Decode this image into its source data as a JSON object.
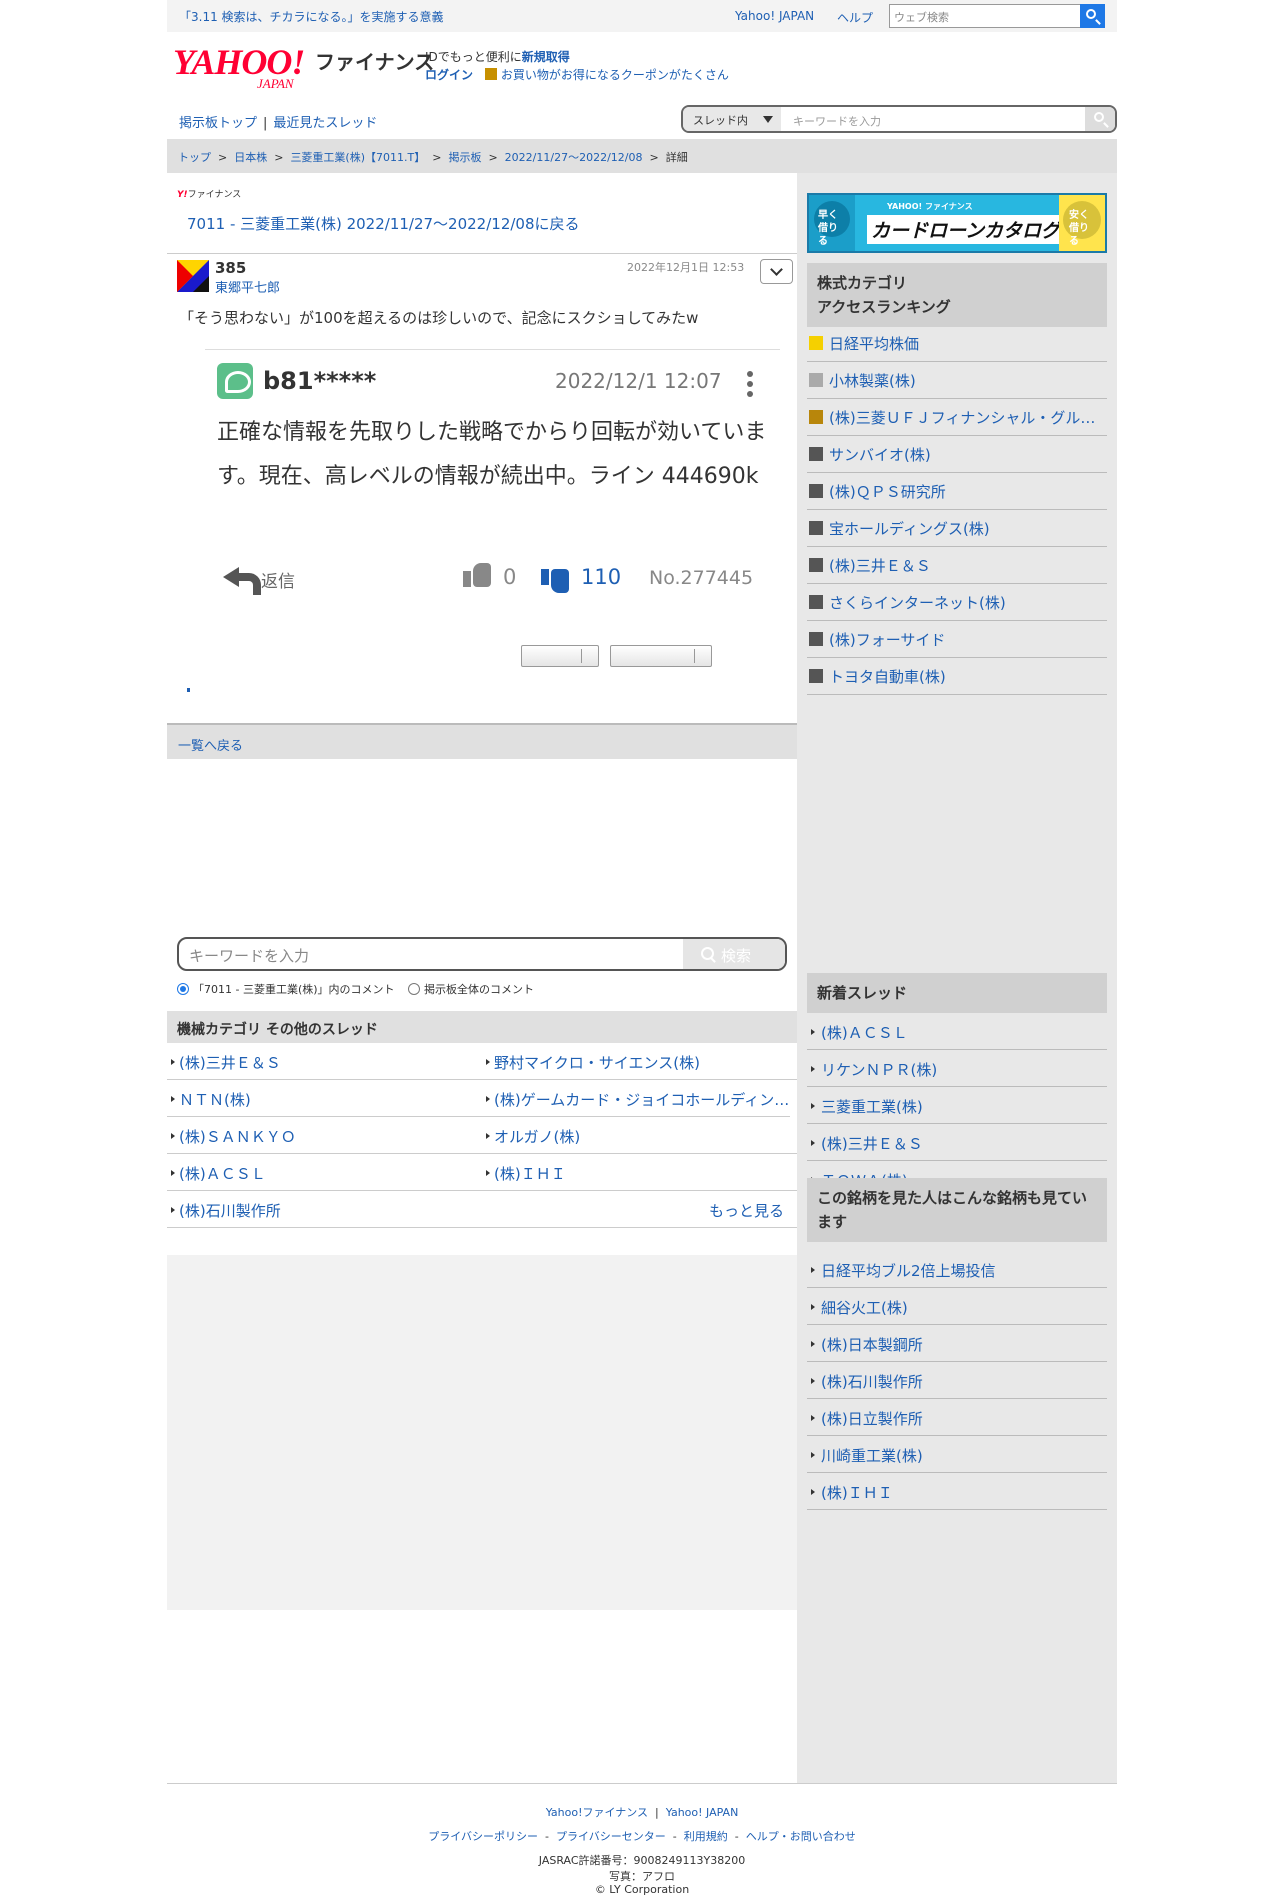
{
  "topbar": {
    "notice": "「3.11 検索は、チカラになる。」を実施する意義",
    "yahoo_japan": "Yahoo! JAPAN",
    "help": "ヘルプ",
    "web_search_placeholder": "ウェブ検索"
  },
  "header": {
    "logo_text": "YAHOO!",
    "logo_sub": "JAPAN",
    "finance": "ファイナンス",
    "id_line_prefix": "IDでもっと便利に",
    "id_line_link": "新規取得",
    "login": "ログイン",
    "coupon": "お買い物がお得になるクーポンがたくさん"
  },
  "subnav": {
    "bbs_top": "掲示板トップ",
    "sep": "|",
    "recent": "最近見たスレッド"
  },
  "bbs_search": {
    "scope": "スレッド内",
    "placeholder": "キーワードを入力"
  },
  "breadcrumb": {
    "items": [
      "トップ",
      "日本株",
      "三菱重工業(株)【7011.T】",
      "掲示板",
      "2022/11/27〜2022/12/08"
    ],
    "separator": ">",
    "current": "詳細"
  },
  "thread": {
    "small_logo": "Y!",
    "small_logo_sub": "ファイナンス",
    "back_link": "7011 - 三菱重工業(株) 2022/11/27〜2022/12/08に戻る"
  },
  "comment": {
    "number": "385",
    "user": "東郷平七郎",
    "date": "2022年12月1日 12:53",
    "text": "「そう思わない」が100を超えるのは珍しいので、記念にスクショしてみたw"
  },
  "screenshot": {
    "user": "b81*****",
    "date": "2022/12/1 12:07",
    "text": "正確な情報を先取りした戦略でからり回転が効いています。現在、高レベルの情報が続出中。ライン 444690k",
    "reply": "返信",
    "likes": "0",
    "dislikes": "110",
    "post_no": "No.277445"
  },
  "back_to_list": "一覧へ戻る",
  "keyword_search": {
    "placeholder": "キーワードを入力",
    "button": "検索",
    "radio_thread": "「7011 - 三菱重工業(株)」内のコメント",
    "radio_all": "掲示板全体のコメント"
  },
  "category": {
    "title": "機械カテゴリ その他のスレッド",
    "items": [
      "(株)三井Ｅ＆Ｓ",
      "野村マイクロ・サイエンス(株)",
      "ＮＴＮ(株)",
      "(株)ゲームカード・ジョイコホールディングス",
      "(株)ＳＡＮＫＹＯ",
      "オルガノ(株)",
      "(株)ＡＣＳＬ",
      "(株)ＩＨＩ",
      "(株)石川製作所"
    ],
    "more": "もっと見る"
  },
  "ad": {
    "left": "早く借りる",
    "right": "安く借りる",
    "brand": "YAHOO! ファイナンス",
    "title": "カードローンカタログ"
  },
  "ranking": {
    "title_line1": "株式カテゴリ",
    "title_line2": "アクセスランキング",
    "items": [
      {
        "label": "日経平均株価",
        "color": "#f5d000"
      },
      {
        "label": "小林製薬(株)",
        "color": "#aaaaaa"
      },
      {
        "label": "(株)三菱ＵＦＪフィナンシャル・グループ",
        "color": "#b8860b"
      },
      {
        "label": "サンバイオ(株)",
        "color": "#555555"
      },
      {
        "label": "(株)ＱＰＳ研究所",
        "color": "#555555"
      },
      {
        "label": "宝ホールディングス(株)",
        "color": "#555555"
      },
      {
        "label": "(株)三井Ｅ＆Ｓ",
        "color": "#555555"
      },
      {
        "label": "さくらインターネット(株)",
        "color": "#555555"
      },
      {
        "label": "(株)フォーサイド",
        "color": "#555555"
      },
      {
        "label": "トヨタ自動車(株)",
        "color": "#555555"
      }
    ]
  },
  "new_threads": {
    "title": "新着スレッド",
    "items": [
      "(株)ＡＣＳＬ",
      "リケンＮＰＲ(株)",
      "三菱重工業(株)",
      "(株)三井Ｅ＆Ｓ",
      "ＴＯＷＡ(株)"
    ]
  },
  "also_viewed": {
    "title": "この銘柄を見た人はこんな銘柄も見ています",
    "items": [
      "日経平均ブル2倍上場投信",
      "細谷火工(株)",
      "(株)日本製鋼所",
      "(株)石川製作所",
      "(株)日立製作所",
      "川崎重工業(株)",
      "(株)ＩＨＩ"
    ]
  },
  "footer": {
    "line1": [
      "Yahoo!ファイナンス",
      "Yahoo! JAPAN"
    ],
    "line1_sep": "|",
    "line2": [
      "プライバシーポリシー",
      "プライバシーセンター",
      "利用規約",
      "ヘルプ・お問い合わせ"
    ],
    "line2_sep": "-",
    "jasrac": "JASRAC許諾番号：9008249113Y38200",
    "photo": "写真：アフロ",
    "copyright": "© LY Corporation"
  }
}
